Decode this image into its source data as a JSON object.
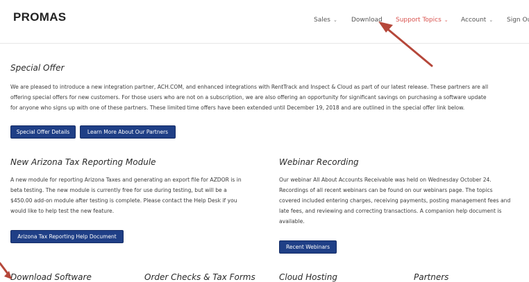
{
  "header": {
    "logo": "PROMAS",
    "nav": [
      {
        "label": "Sales",
        "has_dropdown": true,
        "active": false
      },
      {
        "label": "Download",
        "has_dropdown": false,
        "active": false
      },
      {
        "label": "Support Topics",
        "has_dropdown": true,
        "active": true
      },
      {
        "label": "Account",
        "has_dropdown": true,
        "active": false
      },
      {
        "label": "Sign Out",
        "has_dropdown": false,
        "active": false
      }
    ]
  },
  "special_offer": {
    "title": "Special Offer",
    "lines": [
      "We are pleased to introduce a new integration partner, ACH.COM, and enhanced integrations with RentTrack and Inspect & Cloud as part of our latest release. These partners are all",
      "offering special offers for new customers. For those users who are not on a subscription, we are also offering an opportunity for significant savings on purchasing a software update",
      "for anyone who signs up with one of these partners. These limited time offers have been extended until December 19, 2018 and are outlined in the special offer link below."
    ],
    "buttons": [
      "Special Offer Details",
      "Learn More About Our Partners"
    ]
  },
  "arizona": {
    "title": "New Arizona Tax Reporting Module",
    "lines": [
      "A new module for reporting Arizona Taxes and generating an export file for AZDOR is in",
      "beta testing. The new module is currently free for use during testing, but will be a",
      "$450.00 add-on module after testing is complete. Please contact the Help Desk if you",
      "would like to help test the new feature."
    ],
    "button": "Arizona Tax Reporting Help Document"
  },
  "webinar": {
    "title": "Webinar Recording",
    "lines": [
      "Our webinar All About Accounts Receivable was held on Wednesday October 24.",
      "Recordings of all recent webinars can be found on our webinars page. The topics",
      "covered included entering charges, receiving payments, posting management fees and",
      "late fees, and reviewing and correcting transactions.  A companion help document is",
      "available."
    ],
    "button": "Recent Webinars"
  },
  "bottom_sections": [
    "Download Software",
    "Order Checks & Tax Forms",
    "Cloud Hosting",
    "Partners"
  ],
  "colors": {
    "accent": "#1f3f86",
    "nav_active": "#d9534f",
    "annotation_arrow": "#b5473a"
  }
}
